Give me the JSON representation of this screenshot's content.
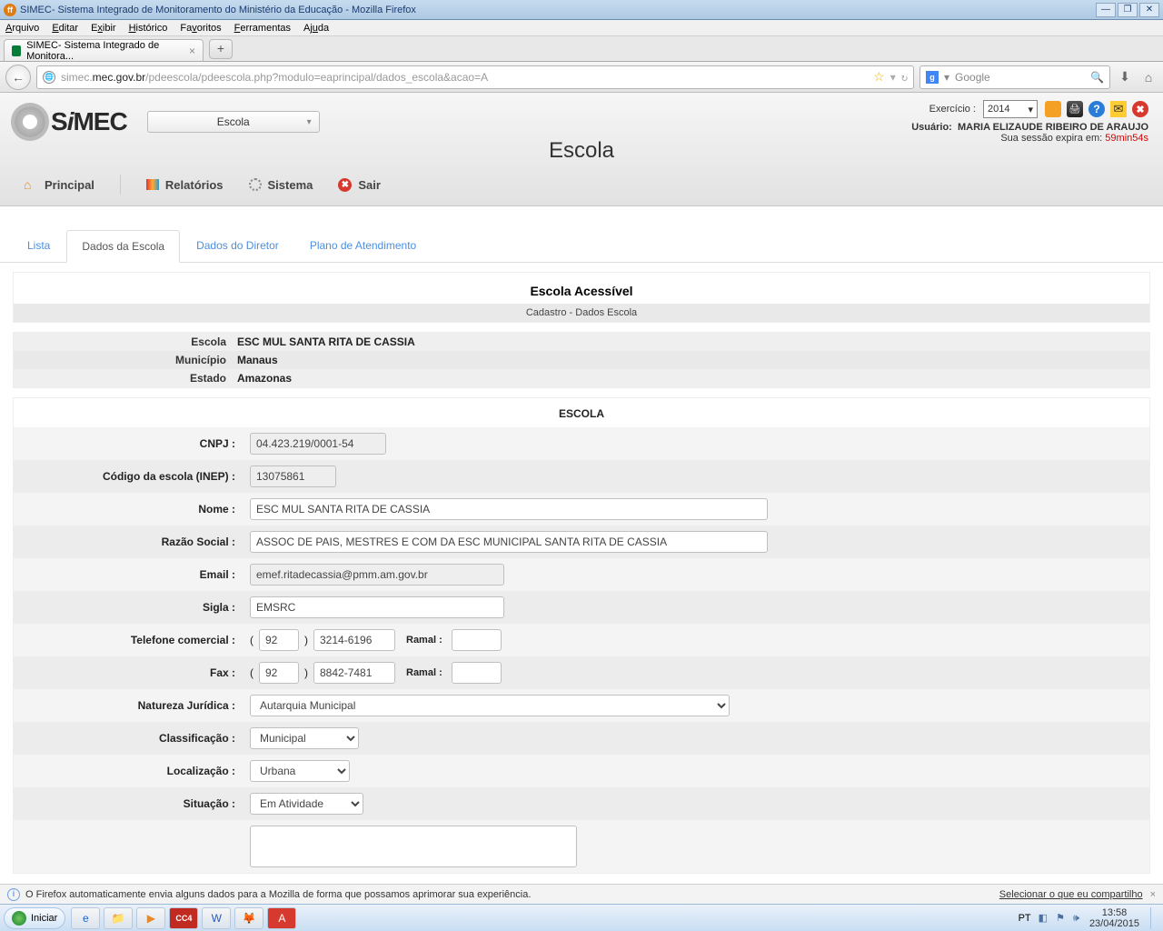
{
  "window": {
    "title": "SIMEC- Sistema Integrado de Monitoramento do Ministério da Educação - Mozilla Firefox",
    "btn_min": "—",
    "btn_max": "❐",
    "btn_close": "✕"
  },
  "menubar": {
    "arquivo": "Arquivo",
    "editar": "Editar",
    "exibir": "Exibir",
    "historico": "Histórico",
    "favoritos": "Favoritos",
    "ferramentas": "Ferramentas",
    "ajuda": "Ajuda"
  },
  "tab": {
    "label": "SIMEC- Sistema Integrado de Monitora...",
    "close": "×",
    "new": "+"
  },
  "navbar": {
    "back": "←",
    "url_prefix": "simec.",
    "url_highlight": "mec.gov.br",
    "url_rest": "/pdeescola/pdeescola.php?modulo=eaprincipal/dados_escola&acao=A",
    "star": "☆",
    "dropdown": "▾",
    "reload": "↻",
    "search_logo": "g",
    "search_placeholder": "Google",
    "search_icon": "🔍",
    "download": "⬇",
    "home": "⌂"
  },
  "app_header": {
    "logo_text": "SiMEC",
    "entity": "Escola",
    "page_title": "Escola",
    "exercicio_label": "Exercício :",
    "year": "2014",
    "usuario_label": "Usuário:",
    "usuario": "MARIA ELIZAUDE RIBEIRO DE ARAUJO",
    "session_text": "Sua sessão expira em:",
    "session_time": "59min54s"
  },
  "main_nav": {
    "principal": "Principal",
    "relatorios": "Relatórios",
    "sistema": "Sistema",
    "sair": "Sair"
  },
  "tabs": {
    "lista": "Lista",
    "dados_escola": "Dados da Escola",
    "dados_diretor": "Dados do Diretor",
    "plano": "Plano de Atendimento"
  },
  "section": {
    "title": "Escola Acessível",
    "subtitle": "Cadastro - Dados Escola"
  },
  "summary": {
    "escola_k": "Escola",
    "escola_v": "ESC MUL SANTA RITA DE CASSIA",
    "municipio_k": "Município",
    "municipio_v": "Manaus",
    "estado_k": "Estado",
    "estado_v": "Amazonas"
  },
  "form": {
    "head": "ESCOLA",
    "cnpj_k": "CNPJ :",
    "cnpj_v": "04.423.219/0001-54",
    "inep_k": "Código da escola (INEP) :",
    "inep_v": "13075861",
    "nome_k": "Nome :",
    "nome_v": "ESC MUL SANTA RITA DE CASSIA",
    "razao_k": "Razão Social :",
    "razao_v": "ASSOC DE PAIS, MESTRES E COM DA ESC MUNICIPAL SANTA RITA DE CASSIA",
    "email_k": "Email :",
    "email_v": "emef.ritadecassia@pmm.am.gov.br",
    "sigla_k": "Sigla :",
    "sigla_v": "EMSRC",
    "tel_k": "Telefone comercial :",
    "tel_ddd": "92",
    "tel_num": "3214-6196",
    "ramal_k": "Ramal :",
    "tel_ramal": "",
    "fax_k": "Fax :",
    "fax_ddd": "92",
    "fax_num": "8842-7481",
    "fax_ramal": "",
    "nat_k": "Natureza Jurídica :",
    "nat_v": "Autarquia Municipal",
    "cla_k": "Classificação :",
    "cla_v": "Municipal",
    "loc_k": "Localização :",
    "loc_v": "Urbana",
    "sit_k": "Situação :",
    "sit_v": "Em Atividade"
  },
  "info_bar": {
    "text": "O Firefox automaticamente envia alguns dados para a Mozilla de forma que possamos aprimorar sua experiência.",
    "share": "Selecionar o que eu compartilho",
    "close": "×"
  },
  "taskbar": {
    "start": "Iniciar",
    "lang": "PT",
    "time": "13:58",
    "date": "23/04/2015"
  }
}
